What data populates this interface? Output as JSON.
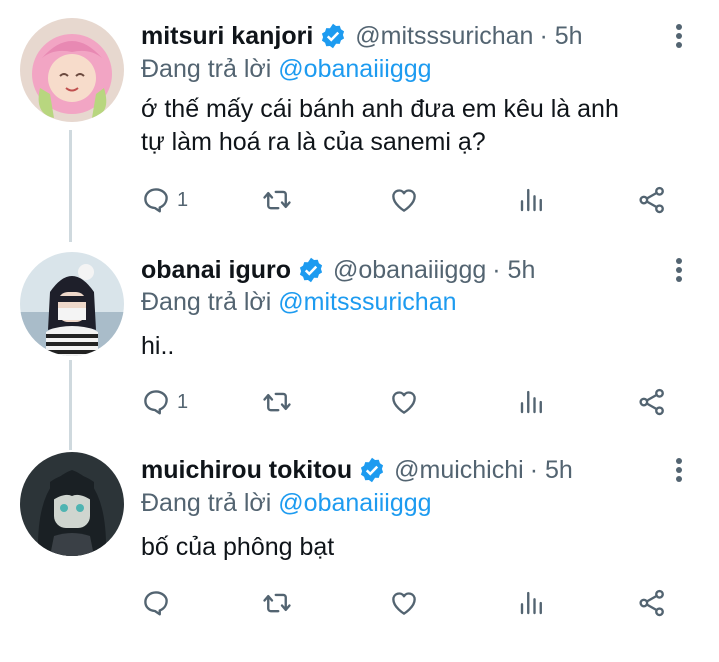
{
  "colors": {
    "accent": "#1d9bf0",
    "muted": "#536471",
    "text": "#0f1419",
    "thread_line": "#cfd9de"
  },
  "tweets": [
    {
      "name": "mitsuri kanjori",
      "handle": "@mitsssurichan",
      "time": "· 5h",
      "reply_prefix": "Đang trả lời",
      "reply_to": "@obanaiiiggg",
      "text_lines": [
        "ớ thế mấy cái bánh anh đưa em kêu là anh",
        "tự làm hoá ra là của sanemi ạ?"
      ],
      "reply_count": "1",
      "avatar_icon": "avatar-pink-hair"
    },
    {
      "name": "obanai iguro",
      "handle": "@obanaiiiggg",
      "time": "· 5h",
      "reply_prefix": "Đang trả lời",
      "reply_to": "@mitsssurichan",
      "text_lines": [
        "hi.."
      ],
      "reply_count": "1",
      "avatar_icon": "avatar-dark-hair-striped"
    },
    {
      "name": "muichirou tokitou",
      "handle": "@muichichi",
      "time": "· 5h",
      "reply_prefix": "Đang trả lời",
      "reply_to": "@obanaiiiggg",
      "text_lines": [
        "bố của phông bạt"
      ],
      "reply_count": "",
      "avatar_icon": "avatar-dark-long-hair"
    }
  ]
}
